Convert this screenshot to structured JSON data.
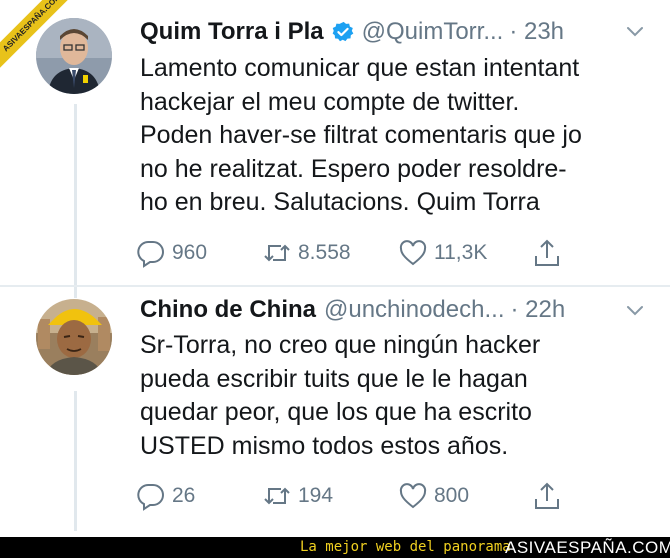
{
  "watermark": {
    "text": "ASIVAESPAÑA.COM"
  },
  "tweets": [
    {
      "name": "Quim Torra i Pla",
      "verified": true,
      "handle": "@QuimTorr...",
      "time": "· 23h",
      "lines": [
        "Lamento comunicar que estan intentant",
        "hackejar el meu compte de twitter.",
        "Poden haver-se filtrat comentaris que jo",
        "no he realitzat. Espero poder resoldre-",
        "ho en breu. Salutacions. Quim Torra"
      ],
      "replies": "960",
      "retweets": "8.558",
      "likes": "11,3K"
    },
    {
      "name": "Chino de China",
      "verified": false,
      "handle": "@unchinodech...",
      "time": "· 22h",
      "lines": [
        "Sr-Torra, no creo que ningún hacker",
        "pueda escribir tuits que le le hagan",
        "quedar peor, que los que ha escrito",
        "USTED mismo todos estos años."
      ],
      "replies": "26",
      "retweets": "194",
      "likes": "800"
    }
  ],
  "footer": {
    "tagline": "La mejor web del panorama",
    "brand": "ASIVAESPAÑA.COM"
  },
  "colors": {
    "text": "#14171a",
    "muted": "#657786",
    "verified": "#1da1f2",
    "footer_bg": "#000000",
    "footer_tagline": "#f0d020"
  }
}
